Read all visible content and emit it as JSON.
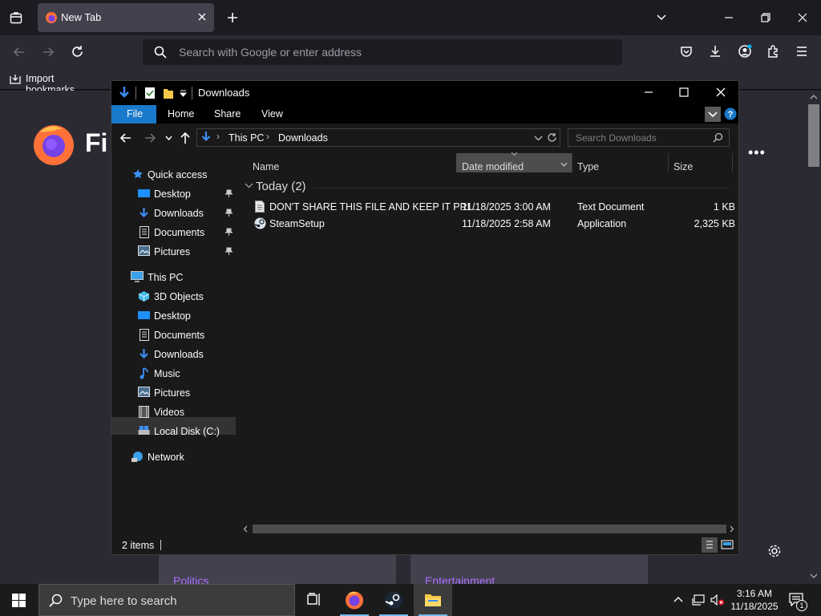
{
  "browser": {
    "tab_title": "New Tab",
    "url_placeholder": "Search with Google or enter address",
    "bookmark_label": "Import bookmarks...",
    "logo_text": "Fi",
    "cards": [
      "Politics",
      "Entertainment"
    ]
  },
  "explorer": {
    "title": "Downloads",
    "ribbon_tabs": [
      "File",
      "Home",
      "Share",
      "View"
    ],
    "breadcrumb": [
      "This PC",
      "Downloads"
    ],
    "search_placeholder": "Search Downloads",
    "nav": {
      "quick_access": "Quick access",
      "quick_items": [
        "Desktop",
        "Downloads",
        "Documents",
        "Pictures"
      ],
      "this_pc": "This PC",
      "pc_items": [
        "3D Objects",
        "Desktop",
        "Documents",
        "Downloads",
        "Music",
        "Pictures",
        "Videos",
        "Local Disk (C:)"
      ],
      "network": "Network"
    },
    "columns": [
      "Name",
      "Date modified",
      "Type",
      "Size"
    ],
    "group": "Today (2)",
    "files": [
      {
        "name": "DON'T SHARE THIS FILE AND KEEP IT PRI...",
        "date": "11/18/2025 3:00 AM",
        "type": "Text Document",
        "size": "1 KB"
      },
      {
        "name": "SteamSetup",
        "date": "11/18/2025 2:58 AM",
        "type": "Application",
        "size": "2,325 KB"
      }
    ],
    "status": "2 items"
  },
  "taskbar": {
    "search_placeholder": "Type here to search",
    "time": "3:16 AM",
    "date": "11/18/2025",
    "notification_count": "1"
  }
}
